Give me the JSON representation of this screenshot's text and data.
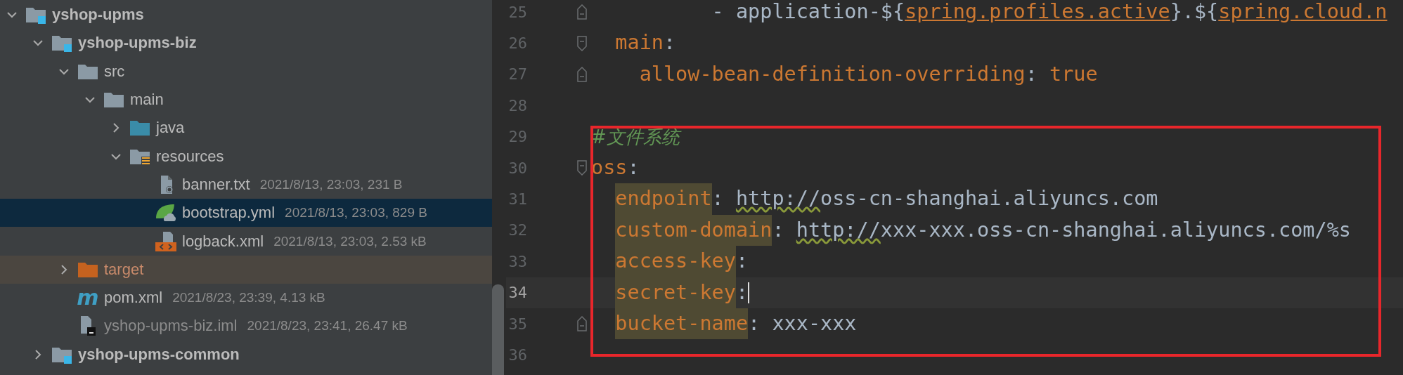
{
  "project_tree": [
    {
      "name": "yshop-upms",
      "kind": "module",
      "expanded": true,
      "selected": false,
      "children": [
        {
          "name": "yshop-upms-biz",
          "kind": "module",
          "expanded": true,
          "selected": false,
          "children": [
            {
              "name": "src",
              "kind": "folder",
              "expanded": true,
              "selected": false,
              "children": [
                {
                  "name": "main",
                  "kind": "folder",
                  "expanded": true,
                  "selected": false,
                  "children": [
                    {
                      "name": "java",
                      "kind": "source-folder",
                      "expanded": false,
                      "selected": false
                    },
                    {
                      "name": "resources",
                      "kind": "resource-folder",
                      "expanded": true,
                      "selected": false,
                      "children": [
                        {
                          "name": "banner.txt",
                          "kind": "text-file",
                          "meta": "2021/8/13, 23:03, 231 B",
                          "selected": false
                        },
                        {
                          "name": "bootstrap.yml",
                          "kind": "spring-file",
                          "meta": "2021/8/13, 23:03, 829 B",
                          "selected": true
                        },
                        {
                          "name": "logback.xml",
                          "kind": "xml-file",
                          "meta": "2021/8/13, 23:03, 2.53 kB",
                          "selected": false
                        }
                      ]
                    }
                  ]
                }
              ]
            },
            {
              "name": "target",
              "kind": "excluded-folder",
              "expanded": false,
              "selected": false
            },
            {
              "name": "pom.xml",
              "kind": "maven-file",
              "icon_glyph": "m",
              "meta": "2021/8/23, 23:39, 4.13 kB",
              "selected": false
            },
            {
              "name": "yshop-upms-biz.iml",
              "kind": "iml-file",
              "meta": "2021/8/23, 23:41, 26.47 kB",
              "selected": false
            }
          ]
        },
        {
          "name": "yshop-upms-common",
          "kind": "module",
          "expanded": false,
          "selected": false
        }
      ]
    }
  ],
  "editor": {
    "lines": [
      {
        "number": "25",
        "kind": "fold-end",
        "current": false,
        "segments": [
          {
            "kind": "value",
            "text": "          - application-${"
          },
          {
            "kind": "ref",
            "text": "spring.profiles.active"
          },
          {
            "kind": "value",
            "text": "}.${"
          },
          {
            "kind": "ref",
            "text": "spring.cloud.n"
          }
        ]
      },
      {
        "number": "26",
        "kind": "fold-start",
        "current": false,
        "segments": [
          {
            "kind": "key",
            "text": "  main"
          },
          {
            "kind": "punct",
            "text": ":"
          }
        ]
      },
      {
        "number": "27",
        "kind": "fold-end",
        "current": false,
        "segments": [
          {
            "kind": "key",
            "text": "    allow-bean-definition-overriding"
          },
          {
            "kind": "punct",
            "text": ": "
          },
          {
            "kind": "bool",
            "text": "true"
          }
        ]
      },
      {
        "number": "28",
        "kind": "plain",
        "current": false
      }
    ],
    "highlight_box": {
      "kind": "outline",
      "lines": [
        {
          "number": "29",
          "kind": "plain",
          "current": false,
          "segments": [
            {
              "kind": "comment",
              "text": "#文件系统"
            }
          ]
        },
        {
          "number": "30",
          "kind": "fold-start",
          "current": false,
          "segments": [
            {
              "kind": "key",
              "text": "oss"
            },
            {
              "kind": "punct",
              "text": ":"
            }
          ]
        },
        {
          "number": "31",
          "kind": "plain",
          "current": false,
          "segments": [
            {
              "kind": "key",
              "text": "  endpoint",
              "highlight": true
            },
            {
              "kind": "punct",
              "text": ": "
            },
            {
              "kind": "typo",
              "text": "http://"
            },
            {
              "kind": "value",
              "text": "oss-cn-shanghai.aliyuncs.com"
            }
          ]
        },
        {
          "number": "32",
          "kind": "plain",
          "current": false,
          "segments": [
            {
              "kind": "key",
              "text": "  custom-domain",
              "highlight": true
            },
            {
              "kind": "punct",
              "text": ": "
            },
            {
              "kind": "typo",
              "text": "http://"
            },
            {
              "kind": "value",
              "text": "xxx-xxx.oss-cn-shanghai.aliyuncs.com/%s"
            }
          ]
        },
        {
          "number": "33",
          "kind": "plain",
          "current": false,
          "segments": [
            {
              "kind": "key",
              "text": "  access-key",
              "highlight": true
            },
            {
              "kind": "punct",
              "text": ":"
            }
          ]
        },
        {
          "number": "34",
          "kind": "plain",
          "current": true,
          "segments": [
            {
              "kind": "key",
              "text": "  secret-key",
              "highlight": true
            },
            {
              "kind": "punct",
              "text": ":"
            }
          ]
        },
        {
          "number": "35",
          "kind": "fold-end",
          "current": false,
          "segments": [
            {
              "kind": "key",
              "text": "  bucket-name",
              "highlight": true
            },
            {
              "kind": "punct",
              "text": ": "
            },
            {
              "kind": "value",
              "text": "xxx-xxx"
            }
          ]
        },
        {
          "number": "36",
          "kind": "plain",
          "current": false
        }
      ]
    }
  }
}
